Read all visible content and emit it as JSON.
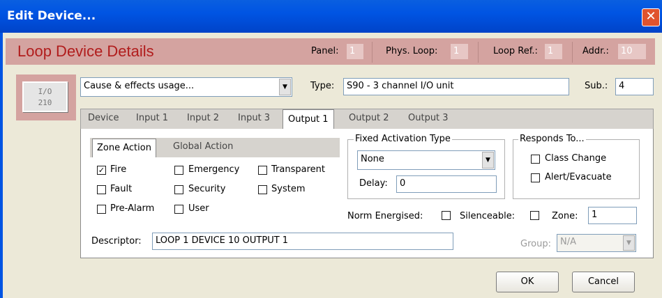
{
  "window": {
    "title": "Edit Device...",
    "close_glyph": "✕"
  },
  "header": {
    "title": "Loop Device Details",
    "panel_label": "Panel:",
    "panel_value": "1",
    "phys_loop_label": "Phys. Loop:",
    "phys_loop_value": "1",
    "loop_ref_label": "Loop Ref.:",
    "loop_ref_value": "1",
    "addr_label": "Addr.:",
    "addr_value": "10"
  },
  "device_icon": {
    "line1": "I/O",
    "line2": "210"
  },
  "usage_select": {
    "value": "Cause & effects usage..."
  },
  "type": {
    "label": "Type:",
    "value": "S90 - 3 channel I/O unit"
  },
  "sub": {
    "label": "Sub.:",
    "value": "4"
  },
  "tabs": [
    {
      "label": "Device"
    },
    {
      "label": "Input 1"
    },
    {
      "label": "Input 2"
    },
    {
      "label": "Input 3"
    },
    {
      "label": "Output 1"
    },
    {
      "label": "Output 2"
    },
    {
      "label": "Output 3"
    }
  ],
  "subtabs": [
    {
      "label": "Zone Action"
    },
    {
      "label": "Global Action"
    }
  ],
  "checkboxes": [
    {
      "label": "Fire",
      "checked": "✓"
    },
    {
      "label": "Emergency",
      "checked": ""
    },
    {
      "label": "Transparent",
      "checked": ""
    },
    {
      "label": "Fault",
      "checked": ""
    },
    {
      "label": "Security",
      "checked": ""
    },
    {
      "label": "System",
      "checked": ""
    },
    {
      "label": "Pre-Alarm",
      "checked": ""
    },
    {
      "label": "User",
      "checked": ""
    }
  ],
  "fixed_activation": {
    "title": "Fixed Activation Type",
    "value": "None",
    "delay_label": "Delay:",
    "delay_value": "0"
  },
  "responds_to": {
    "title": "Responds To...",
    "class_change": "Class Change",
    "alert_evacuate": "Alert/Evacuate"
  },
  "options": {
    "norm_energised": "Norm Energised:",
    "silenceable": "Silenceable:",
    "zone_label": "Zone:",
    "zone_value": "1"
  },
  "descriptor": {
    "label": "Descriptor:",
    "value": "LOOP 1 DEVICE 10 OUTPUT 1"
  },
  "group": {
    "label": "Group:",
    "value": "N/A"
  },
  "buttons": {
    "ok": "OK",
    "cancel": "Cancel"
  }
}
